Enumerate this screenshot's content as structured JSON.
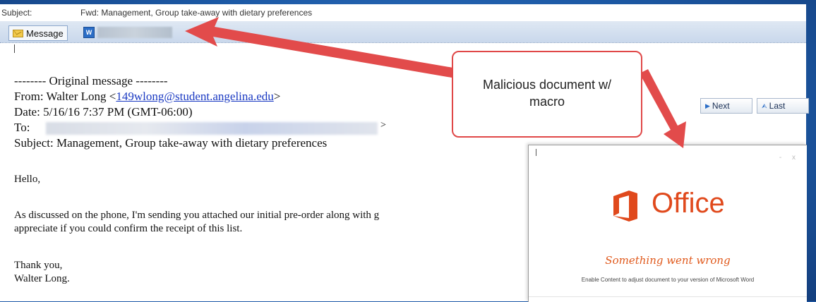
{
  "subject_bar": {
    "label": "Subject:",
    "value": "Fwd: Management, Group take-away with dietary preferences"
  },
  "tabs": {
    "message_label": "Message",
    "word_icon_glyph": "W"
  },
  "email": {
    "original_header": "-------- Original message --------",
    "from_prefix": "From: Walter Long <",
    "from_email": "149wlong@student.angelina.edu",
    "from_suffix": ">",
    "date": "Date: 5/16/16 7:37 PM (GMT-06:00)",
    "to_label": "To:",
    "to_suffix": ">",
    "subject": "Subject: Management, Group take-away with dietary preferences",
    "greeting": "Hello,",
    "paragraph_line1": "As discussed on the phone, I'm sending you attached our initial pre-order along with g",
    "paragraph_line2": "appreciate if you could confirm the receipt of this list.",
    "closing": "Thank you,",
    "signature": "Walter Long."
  },
  "nav": {
    "next_label": "Next",
    "last_label": "Last"
  },
  "callout": {
    "line1": "Malicious document w/",
    "line2": "macro"
  },
  "office_popup": {
    "brand": "Office",
    "error_title": "Something went wrong",
    "instruction": "Enable Content to adjust document to your version of Microsoft Word",
    "window_controls": "- x"
  },
  "colors": {
    "accent_red": "#e04848",
    "office_orange": "#e0491c",
    "link_blue": "#1a39c2",
    "background_blue": "#1f5aa8"
  }
}
